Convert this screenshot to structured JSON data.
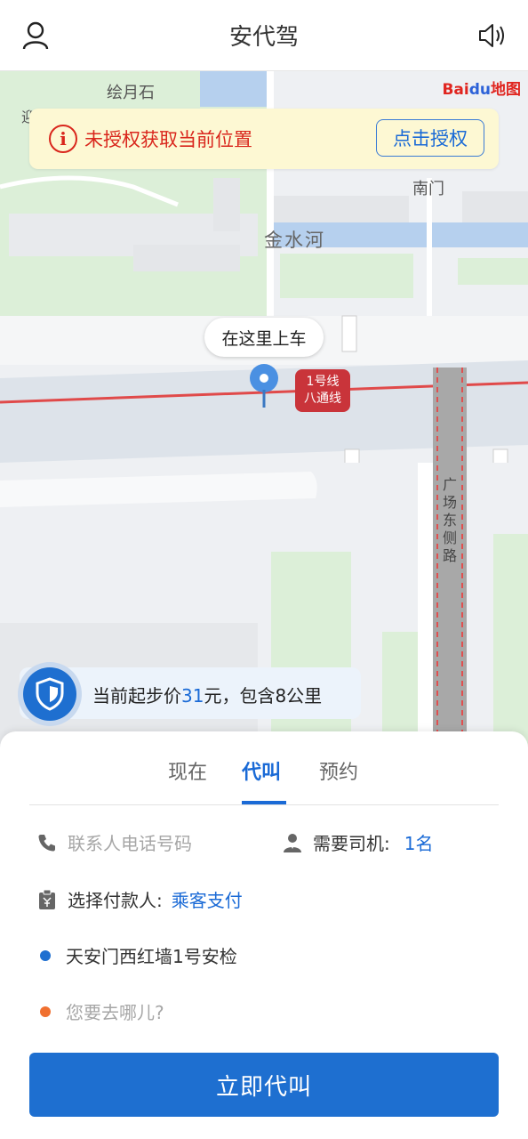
{
  "header": {
    "title": "安代驾",
    "user_icon": "user-icon",
    "sound_icon": "speaker-icon"
  },
  "map": {
    "labels": {
      "huiyueshi": "绘月石",
      "ying": "迎",
      "nanmen": "南门",
      "jinshuihe": "金水河",
      "road": "广场东侧路"
    },
    "logo": {
      "red": "Bai",
      "blue": "du",
      "suffix": "地图"
    },
    "auth_banner": {
      "text": "未授权获取当前位置",
      "button": "点击授权"
    },
    "pickup_bubble": "在这里上车",
    "metro": {
      "line1": "1号线",
      "line2": "八通线"
    },
    "price": {
      "prefix": "当前起步价",
      "amount": "31",
      "suffix": "元，包含8公里"
    }
  },
  "tabs": [
    {
      "label": "现在",
      "active": false
    },
    {
      "label": "代叫",
      "active": true
    },
    {
      "label": "预约",
      "active": false
    }
  ],
  "form": {
    "phone_placeholder": "联系人电话号码",
    "driver_label": "需要司机:",
    "driver_value": "1名",
    "payer_label": "选择付款人:",
    "payer_value": "乘客支付",
    "origin": "天安门西红墙1号安检",
    "destination_placeholder": "您要去哪儿?"
  },
  "call_button": "立即代叫",
  "colors": {
    "accent": "#1e6fd0",
    "warning": "#d9261c",
    "origin_dot": "#1e6fd0",
    "destination_dot": "#f07030"
  }
}
